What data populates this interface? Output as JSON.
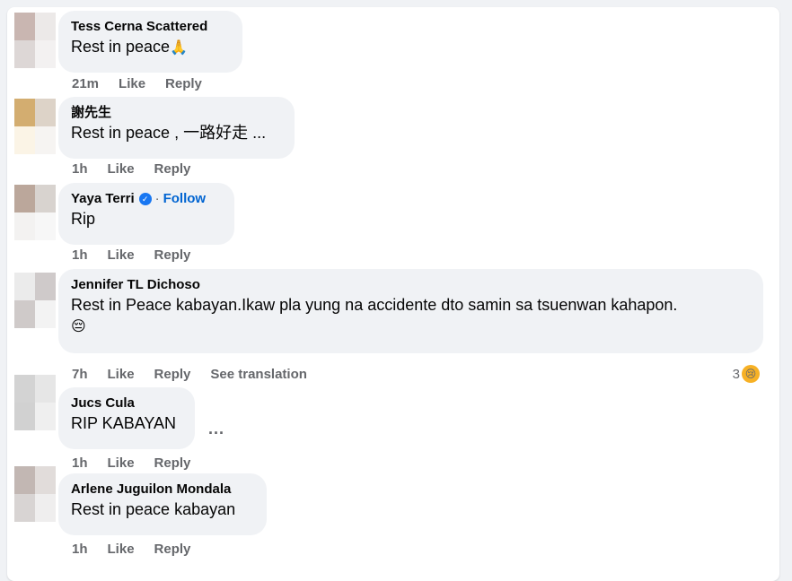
{
  "comments": [
    {
      "name": "Tess Cerna Scattered",
      "text": "Rest in peace",
      "emoji": "🙏",
      "time": "21m",
      "like": "Like",
      "reply": "Reply",
      "avatar_colors": [
        "#c9b6b1",
        "#ece9e8",
        "#ddd7d6",
        "#f3f1f1"
      ]
    },
    {
      "name": "謝先生",
      "text": "Rest in peace , 一路好走 ...",
      "time": "1h",
      "like": "Like",
      "reply": "Reply",
      "avatar_colors": [
        "#d3ad70",
        "#ddd3c8",
        "#fbf4e6",
        "#f6f4f2"
      ]
    },
    {
      "name": "Yaya Terri",
      "badge": "✓",
      "separator": "·",
      "follow": "Follow",
      "text": "Rip",
      "time": "1h",
      "like": "Like",
      "reply": "Reply",
      "avatar_colors": [
        "#bba79b",
        "#d8d3cf",
        "#f3f2f1",
        "#f7f7f7"
      ]
    },
    {
      "name": "Jennifer TL Dichoso",
      "text": "Rest in Peace kabayan.Ikaw pla yung na accidente dto samin sa tsuenwan kahapon.",
      "text2": "😔",
      "time": "7h",
      "like": "Like",
      "reply": "Reply",
      "translate": "See translation",
      "reaction_count": "3",
      "reaction_emoji": "😢",
      "avatar_colors": [
        "#ebebeb",
        "#cfcaca",
        "#cfcac9",
        "#f3f3f3"
      ]
    },
    {
      "name": "Jucs Cula",
      "text": "RIP KABAYAN",
      "more": "...",
      "time": "1h",
      "like": "Like",
      "reply": "Reply",
      "avatar_colors": [
        "#d3d3d3",
        "#e6e6e6",
        "#d1d1d1",
        "#efefef"
      ]
    },
    {
      "name": "Arlene Juguilon Mondala",
      "text": "Rest in peace kabayan",
      "time": "1h",
      "like": "Like",
      "reply": "Reply",
      "avatar_colors": [
        "#c2b7b3",
        "#e1dcda",
        "#d8d4d3",
        "#efeeee"
      ]
    }
  ]
}
